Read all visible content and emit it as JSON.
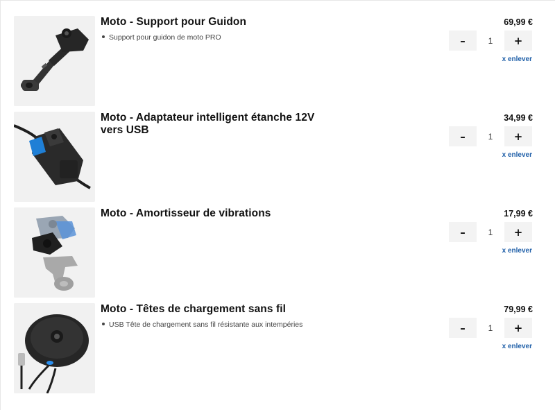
{
  "cart": {
    "items": [
      {
        "title": "Moto - Support pour Guidon",
        "description": "Support pour guidon de moto PRO",
        "price": "69,99 €",
        "quantity": "1",
        "decrement_label": "–",
        "increment_label": "+",
        "remove_label": "x enlever",
        "image_icon": "handlebar-mount-product-image"
      },
      {
        "title": "Moto - Adaptateur intelligent étanche 12V vers USB",
        "description": "",
        "price": "34,99 €",
        "quantity": "1",
        "decrement_label": "–",
        "increment_label": "+",
        "remove_label": "x enlever",
        "image_icon": "usb-adapter-product-image"
      },
      {
        "title": "Moto - Amortisseur de vibrations",
        "description": "",
        "price": "17,99 €",
        "quantity": "1",
        "decrement_label": "–",
        "increment_label": "+",
        "remove_label": "x enlever",
        "image_icon": "vibration-dampener-product-image"
      },
      {
        "title": "Moto - Têtes de chargement sans fil",
        "description": "USB Tête de chargement sans fil résistante aux intempéries",
        "price": "79,99 €",
        "quantity": "1",
        "decrement_label": "–",
        "increment_label": "+",
        "remove_label": "x enlever",
        "image_icon": "wireless-charging-head-product-image"
      }
    ]
  },
  "colors": {
    "link": "#1f5fa8",
    "stepper_bg": "#f3f3f3",
    "thumb_bg": "#f1f1f1"
  }
}
